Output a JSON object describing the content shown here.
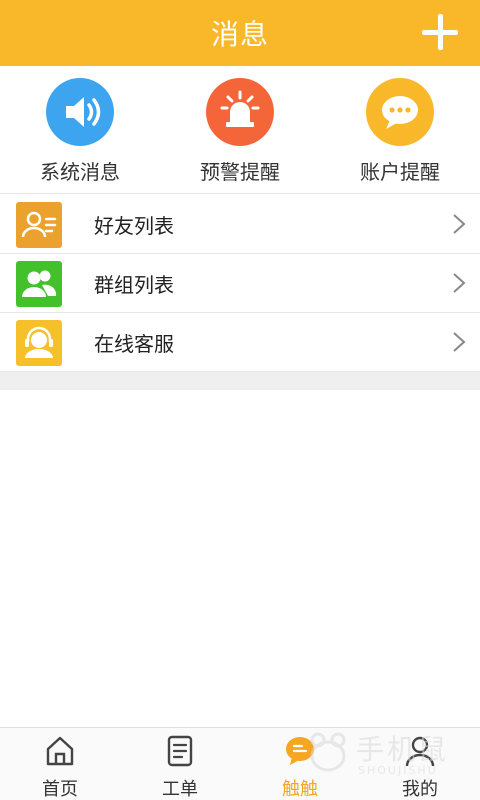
{
  "header": {
    "title": "消息",
    "add_icon": "plus-icon"
  },
  "quick_actions": [
    {
      "label": "系统消息",
      "icon": "speaker-icon",
      "color": "#3da4f0"
    },
    {
      "label": "预警提醒",
      "icon": "alarm-light-icon",
      "color": "#f4653a"
    },
    {
      "label": "账户提醒",
      "icon": "chat-bubble-icon",
      "color": "#f9b82a"
    }
  ],
  "list": [
    {
      "label": "好友列表",
      "icon": "contact-card-icon",
      "color": "#eaa12d"
    },
    {
      "label": "群组列表",
      "icon": "group-icon",
      "color": "#43c12b"
    },
    {
      "label": "在线客服",
      "icon": "headset-icon",
      "color": "#f5c02a"
    }
  ],
  "bottom_nav": [
    {
      "label": "首页",
      "icon": "home-icon",
      "active": false
    },
    {
      "label": "工单",
      "icon": "document-icon",
      "active": false
    },
    {
      "label": "触触",
      "icon": "chat-icon",
      "active": true
    },
    {
      "label": "我的",
      "icon": "user-icon",
      "active": false
    }
  ],
  "watermark": {
    "text": "手机鼠",
    "sub": "SHOUJISHU"
  },
  "colors": {
    "header": "#f9b82a",
    "active_nav": "#f5a623",
    "list_separator": "#e6e6e6"
  }
}
